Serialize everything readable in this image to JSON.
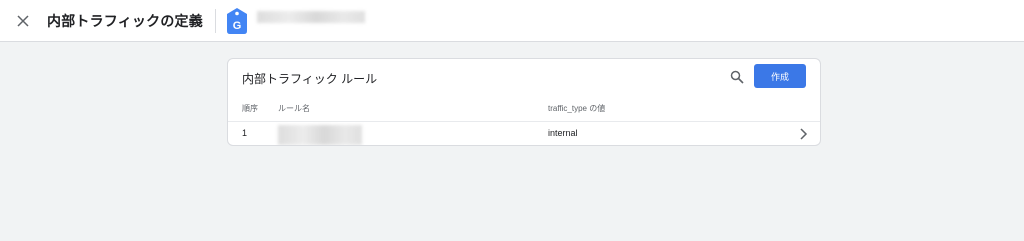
{
  "header": {
    "title": "内部トラフィックの定義",
    "account_name": "",
    "logo_letter": "G"
  },
  "card": {
    "title": "内部トラフィック ルール",
    "create_label": "作成",
    "columns": [
      "順序",
      "ルール名",
      "traffic_type の値"
    ],
    "rows": [
      {
        "order": "1",
        "rule_name": "",
        "traffic_type": "internal"
      }
    ]
  },
  "icons": {
    "close": "close-icon",
    "search": "search-icon",
    "chevron": "chevron-right-icon",
    "logo": "google-tag-icon"
  },
  "colors": {
    "accent": "#3b78e7",
    "logo": "#4285f4",
    "background": "#f1f3f4"
  }
}
